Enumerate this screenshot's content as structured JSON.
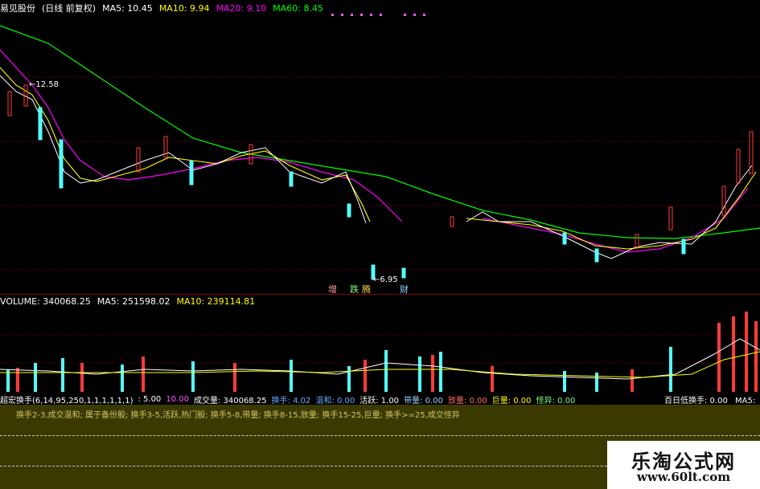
{
  "header": {
    "stock_name": "易见股份",
    "period": "(日线 前复权)",
    "ma5": "MA5: 10.45",
    "ma10": "MA10: 9.94",
    "ma20": "MA20: 9.10",
    "ma60": "MA60: 8.45"
  },
  "price_annotations": {
    "high_label": "12.58",
    "low_label": "6.95"
  },
  "event_markers": [
    "增",
    "跌",
    "腾",
    "财"
  ],
  "volume": {
    "title": "VOLUME: 340068.25",
    "ma5": "MA5: 251598.02",
    "ma10": "MA10: 239114.81"
  },
  "indicator": {
    "name": "超宏换手(6,14,95,250,1,1,1,1,1,1)",
    "v1": ": 5.00",
    "v2": "10.00",
    "vol": "成交量: 340068.25",
    "huanshou": "换手: 4.02",
    "wenjian": "温和: 0.00",
    "huoyue": "活跃: 1.00",
    "dailiang": "带量: 0.00",
    "fangliang": "放量: 0.00",
    "juliang": "巨量: 0.00",
    "guaiyi": "怪异: 0.00",
    "baiday": "百日低换手: 0.00",
    "ma5": "MA5:"
  },
  "notes": {
    "line": "换手2-3,成交温和; 属于备份股; 换手3-5,活跃,热门股; 换手5-8,带量; 换手8-15,放量; 换手15-25,巨量; 换手>=25,成交怪异"
  },
  "watermark": {
    "title": "乐淘公式网",
    "url": "www.60lt.com"
  },
  "colors": {
    "ma5": "#ffffff",
    "ma10": "#ffff00",
    "ma20": "#ff00ff",
    "ma60": "#00ff00",
    "up": "#ff3b3b",
    "down": "#54ffff"
  }
}
